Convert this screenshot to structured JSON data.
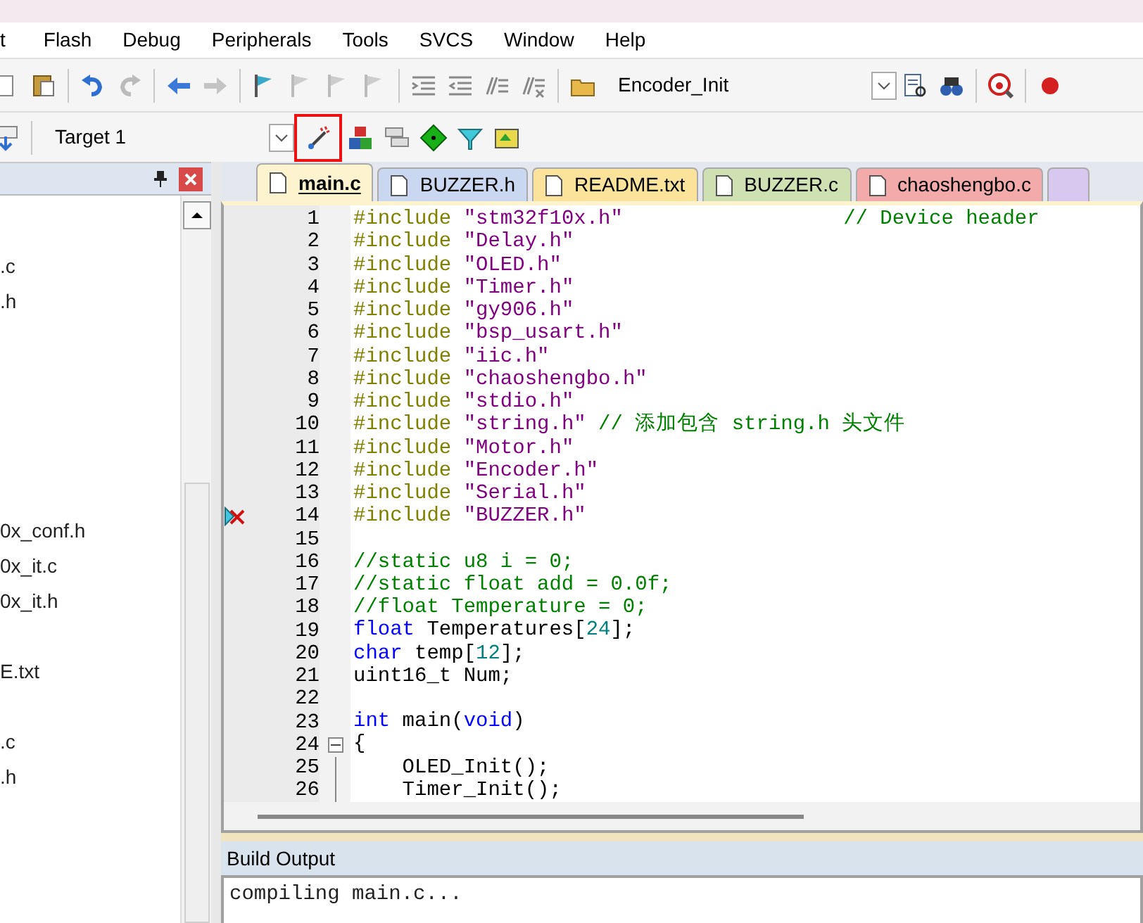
{
  "menu": [
    {
      "label": "t"
    },
    {
      "label": "Flash"
    },
    {
      "label": "Debug"
    },
    {
      "label": "Peripherals"
    },
    {
      "label": "Tools"
    },
    {
      "label": "SVCS"
    },
    {
      "label": "Window"
    },
    {
      "label": "Help"
    }
  ],
  "toolbar": {
    "function_combo": "Encoder_Init",
    "target_combo": "Target 1",
    "wand_highlighted": true
  },
  "project_tree": {
    "groups": [
      {
        "items": [
          ".c",
          ".h"
        ]
      },
      {
        "items": [
          "0x_conf.h",
          "0x_it.c",
          "0x_it.h"
        ]
      },
      {
        "items": [
          "E.txt"
        ]
      },
      {
        "items": [
          ".c",
          ".h"
        ]
      }
    ]
  },
  "tabs": [
    {
      "label": "main.c",
      "selected": true,
      "color": "#fdf3cf"
    },
    {
      "label": "BUZZER.h",
      "selected": false,
      "color": "#c9d8f0"
    },
    {
      "label": "README.txt",
      "selected": false,
      "color": "#fbe39c"
    },
    {
      "label": "BUZZER.c",
      "selected": false,
      "color": "#cfe0b2"
    },
    {
      "label": "chaoshengbo.c",
      "selected": false,
      "color": "#f2aaaa"
    }
  ],
  "code": [
    {
      "n": "1",
      "tokens": [
        {
          "kind": "directive",
          "text": "#include "
        },
        {
          "kind": "string",
          "text": "\"stm32f10x.h\""
        },
        {
          "kind": "comment",
          "text": "                  // Device header"
        }
      ]
    },
    {
      "n": "2",
      "tokens": [
        {
          "kind": "directive",
          "text": "#include "
        },
        {
          "kind": "string",
          "text": "\"Delay.h\""
        }
      ]
    },
    {
      "n": "3",
      "tokens": [
        {
          "kind": "directive",
          "text": "#include "
        },
        {
          "kind": "string",
          "text": "\"OLED.h\""
        }
      ]
    },
    {
      "n": "4",
      "tokens": [
        {
          "kind": "directive",
          "text": "#include "
        },
        {
          "kind": "string",
          "text": "\"Timer.h\""
        }
      ]
    },
    {
      "n": "5",
      "tokens": [
        {
          "kind": "directive",
          "text": "#include "
        },
        {
          "kind": "string",
          "text": "\"gy906.h\""
        }
      ]
    },
    {
      "n": "6",
      "tokens": [
        {
          "kind": "directive",
          "text": "#include "
        },
        {
          "kind": "string",
          "text": "\"bsp_usart.h\""
        }
      ]
    },
    {
      "n": "7",
      "tokens": [
        {
          "kind": "directive",
          "text": "#include "
        },
        {
          "kind": "string",
          "text": "\"iic.h\""
        }
      ]
    },
    {
      "n": "8",
      "tokens": [
        {
          "kind": "directive",
          "text": "#include "
        },
        {
          "kind": "string",
          "text": "\"chaoshengbo.h\""
        }
      ]
    },
    {
      "n": "9",
      "tokens": [
        {
          "kind": "directive",
          "text": "#include "
        },
        {
          "kind": "string",
          "text": "\"stdio.h\""
        }
      ]
    },
    {
      "n": "10",
      "tokens": [
        {
          "kind": "directive",
          "text": "#include "
        },
        {
          "kind": "string",
          "text": "\"string.h\""
        },
        {
          "kind": "comment",
          "text": " // 添加包含 string.h 头文件"
        }
      ]
    },
    {
      "n": "11",
      "tokens": [
        {
          "kind": "directive",
          "text": "#include "
        },
        {
          "kind": "string",
          "text": "\"Motor.h\""
        }
      ]
    },
    {
      "n": "12",
      "tokens": [
        {
          "kind": "directive",
          "text": "#include "
        },
        {
          "kind": "string",
          "text": "\"Encoder.h\""
        }
      ]
    },
    {
      "n": "13",
      "tokens": [
        {
          "kind": "directive",
          "text": "#include "
        },
        {
          "kind": "string",
          "text": "\"Serial.h\""
        }
      ]
    },
    {
      "n": "14",
      "error_marker": true,
      "tokens": [
        {
          "kind": "directive",
          "text": "#include "
        },
        {
          "kind": "string",
          "text": "\"BUZZER.h\""
        }
      ]
    },
    {
      "n": "15"
    },
    {
      "n": "16",
      "tokens": [
        {
          "kind": "comment",
          "text": "//static u8 i = 0;"
        }
      ]
    },
    {
      "n": "17",
      "tokens": [
        {
          "kind": "comment",
          "text": "//static float add = 0.0f;"
        }
      ]
    },
    {
      "n": "18",
      "tokens": [
        {
          "kind": "comment",
          "text": "//float Temperature = 0;"
        }
      ]
    },
    {
      "n": "19",
      "tokens": [
        {
          "kind": "keyword",
          "text": "float"
        },
        {
          "kind": "plain",
          "text": " Temperatures["
        },
        {
          "kind": "number",
          "text": "24"
        },
        {
          "kind": "plain",
          "text": "];"
        }
      ]
    },
    {
      "n": "20",
      "tokens": [
        {
          "kind": "keyword",
          "text": "char"
        },
        {
          "kind": "plain",
          "text": " temp["
        },
        {
          "kind": "number",
          "text": "12"
        },
        {
          "kind": "plain",
          "text": "];"
        }
      ]
    },
    {
      "n": "21",
      "tokens": [
        {
          "kind": "plain",
          "text": "uint16_t Num;"
        }
      ]
    },
    {
      "n": "22"
    },
    {
      "n": "23",
      "tokens": [
        {
          "kind": "keyword",
          "text": "int"
        },
        {
          "kind": "plain",
          "text": " main("
        },
        {
          "kind": "keyword",
          "text": "void"
        },
        {
          "kind": "plain",
          "text": ")"
        }
      ]
    },
    {
      "n": "24",
      "fold_toggle": true,
      "tokens": [
        {
          "kind": "plain",
          "text": "{"
        }
      ]
    },
    {
      "n": "25",
      "fold_line": true,
      "tokens": [
        {
          "kind": "plain",
          "text": "    OLED_Init();"
        }
      ]
    },
    {
      "n": "26",
      "fold_line": true,
      "tokens": [
        {
          "kind": "plain",
          "text": "    Timer_Init();"
        }
      ]
    }
  ],
  "build_output": {
    "title": "Build Output",
    "lines": [
      "compiling main.c..."
    ]
  }
}
